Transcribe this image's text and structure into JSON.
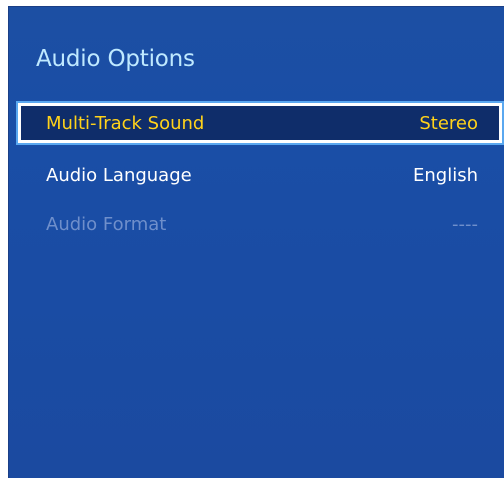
{
  "panel": {
    "title": "Audio Options"
  },
  "menu": {
    "items": [
      {
        "label": "Multi-Track Sound",
        "value": "Stereo",
        "state": "selected"
      },
      {
        "label": "Audio Language",
        "value": "English",
        "state": "normal"
      },
      {
        "label": "Audio Format",
        "value": "----",
        "state": "disabled"
      }
    ]
  },
  "colors": {
    "panel_background": "#1a4ea6",
    "title_text": "#bfe9ff",
    "selected_background": "#0f2d6a",
    "selected_text": "#ffd21a",
    "normal_text": "#ffffff",
    "disabled_text": "#6f8fcb"
  }
}
